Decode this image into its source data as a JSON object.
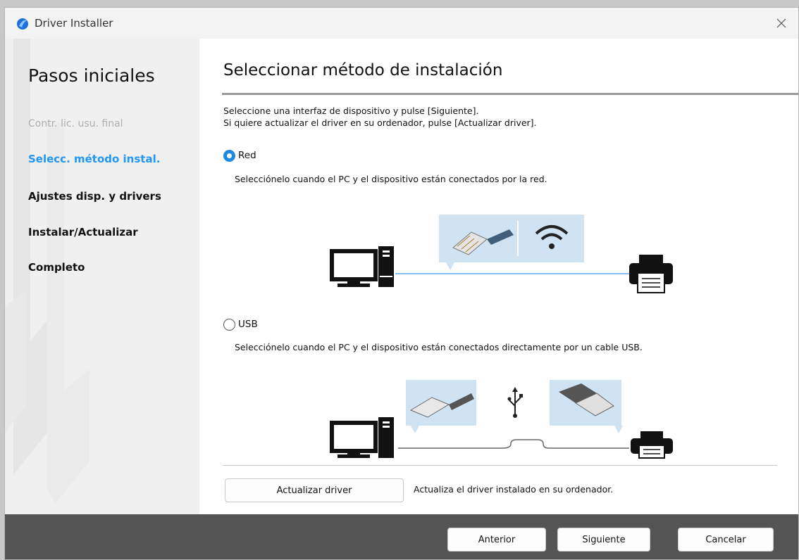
{
  "window": {
    "title": "Driver Installer",
    "icon": "app-logo-icon",
    "close_icon": "close-icon"
  },
  "sidebar": {
    "title": "Pasos iniciales",
    "steps": [
      {
        "label": "Contr. lic. usu. final",
        "state": "done"
      },
      {
        "label": "Selecc. método instal.",
        "state": "current"
      },
      {
        "label": "Ajustes disp. y drivers",
        "state": "pending"
      },
      {
        "label": "Instalar/Actualizar",
        "state": "pending"
      },
      {
        "label": "Completo",
        "state": "pending"
      }
    ]
  },
  "main": {
    "title": "Seleccionar método de instalación",
    "instructions": [
      "Seleccione una interfaz de dispositivo y pulse [Siguiente].",
      "Si quiere actualizar el driver en su ordenador, pulse [Actualizar driver]."
    ],
    "options": [
      {
        "label": "Red",
        "selected": true,
        "description": "Selecciónelo cuando el PC y el dispositivo están conectados por la red."
      },
      {
        "label": "USB",
        "selected": false,
        "description": "Selecciónelo cuando el PC y el dispositivo están conectados directamente por un cable USB."
      }
    ],
    "update_button": "Actualizar driver",
    "update_description": "Actualiza el driver instalado en su ordenador."
  },
  "footer": {
    "back": "Anterior",
    "next": "Siguiente",
    "cancel": "Cancelar"
  },
  "colors": {
    "accent": "#2196f3",
    "radio_selected": "#1e88e5",
    "illustration_bg": "#cfe3f2",
    "cable": "#5aa9e6",
    "footer": "#545454",
    "sidebar": "#f0f0f0"
  }
}
